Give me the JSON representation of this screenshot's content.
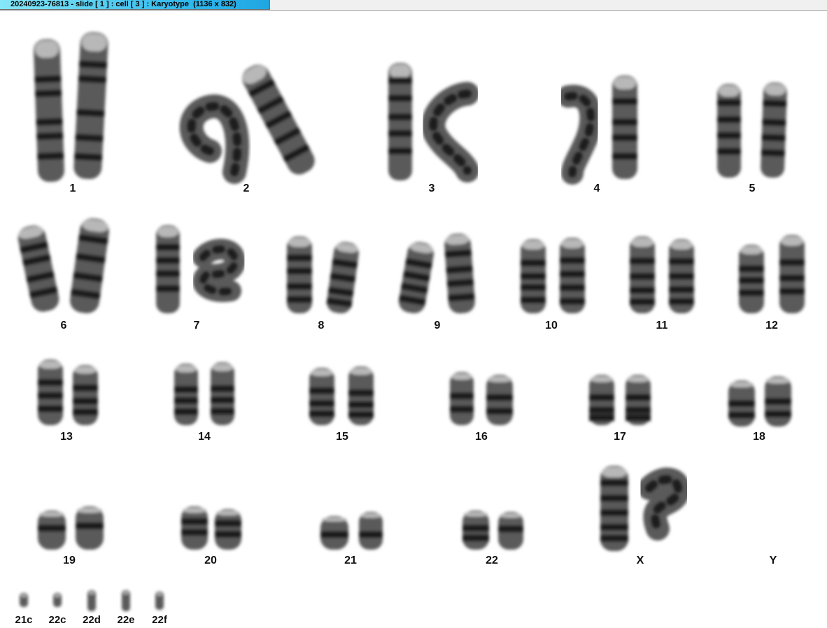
{
  "window": {
    "title": "20240923-76813 - slide [ 1 ] : cell [ 3 ] : Karyotype  (1136 x 832)"
  },
  "karyotype": {
    "labels": {
      "c1": "1",
      "c2": "2",
      "c3": "3",
      "c4": "4",
      "c5": "5",
      "c6": "6",
      "c7": "7",
      "c8": "8",
      "c9": "9",
      "c10": "10",
      "c11": "11",
      "c12": "12",
      "c13": "13",
      "c14": "14",
      "c15": "15",
      "c16": "16",
      "c17": "17",
      "c18": "18",
      "c19": "19",
      "c20": "20",
      "c21": "21",
      "c22": "22",
      "cX": "X",
      "cY": "Y",
      "m21c": "21c",
      "m22c": "22c",
      "m22d": "22d",
      "m22e": "22e",
      "m22f": "22f"
    },
    "colors": {
      "chromatin": "#5a5a5a",
      "dark_band": "#1e1e1e",
      "light_band": "#b8b8b8"
    }
  }
}
